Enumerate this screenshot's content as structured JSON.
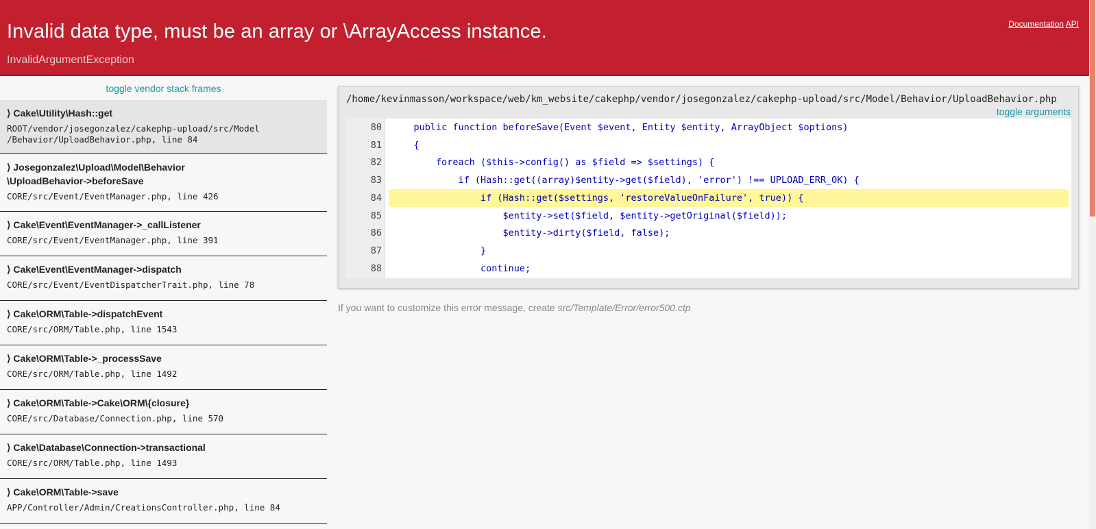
{
  "header": {
    "title": "Invalid data type, must be an array or \\ArrayAccess instance.",
    "exception": "InvalidArgumentException",
    "links": [
      "Documentation",
      "API"
    ]
  },
  "colors": {
    "header_bg": "#c3202f",
    "accent": "#1798a5",
    "highlight": "#fff799"
  },
  "stack": {
    "toggle_label": "toggle vendor stack frames",
    "frames": [
      {
        "fn": "⟩ Cake\\Utility\\Hash::get",
        "loc": "ROOT/vendor/josegonzalez/cakephp-upload/src/Model\n/Behavior/UploadBehavior.php, line 84",
        "active": true
      },
      {
        "fn": "⟩ Josegonzalez\\Upload\\Model\\Behavior\n\\UploadBehavior->beforeSave",
        "loc": "CORE/src/Event/EventManager.php, line 426",
        "active": false
      },
      {
        "fn": "⟩ Cake\\Event\\EventManager->_callListener",
        "loc": "CORE/src/Event/EventManager.php, line 391",
        "active": false
      },
      {
        "fn": "⟩ Cake\\Event\\EventManager->dispatch",
        "loc": "CORE/src/Event/EventDispatcherTrait.php, line 78",
        "active": false
      },
      {
        "fn": "⟩ Cake\\ORM\\Table->dispatchEvent",
        "loc": "CORE/src/ORM/Table.php, line 1543",
        "active": false
      },
      {
        "fn": "⟩ Cake\\ORM\\Table->_processSave",
        "loc": "CORE/src/ORM/Table.php, line 1492",
        "active": false
      },
      {
        "fn": "⟩ Cake\\ORM\\Table->Cake\\ORM\\{closure}",
        "loc": "CORE/src/Database/Connection.php, line 570",
        "active": false
      },
      {
        "fn": "⟩ Cake\\Database\\Connection->transactional",
        "loc": "CORE/src/ORM/Table.php, line 1493",
        "active": false
      },
      {
        "fn": "⟩ Cake\\ORM\\Table->save",
        "loc": "APP/Controller/Admin/CreationsController.php, line 84",
        "active": false
      }
    ]
  },
  "source": {
    "path": "/home/kevinmasson/workspace/web/km_website/cakephp/vendor/josegonzalez/cakephp-upload/src/Model/Behavior/UploadBehavior.php",
    "toggle_args_label": "toggle arguments",
    "highlight_line": 84,
    "lines": [
      {
        "num": "80",
        "code": "    public function beforeSave(Event $event, Entity $entity, ArrayObject $options)"
      },
      {
        "num": "81",
        "code": "    {"
      },
      {
        "num": "82",
        "code": "        foreach ($this->config() as $field => $settings) {"
      },
      {
        "num": "83",
        "code": "            if (Hash::get((array)$entity->get($field), 'error') !== UPLOAD_ERR_OK) {"
      },
      {
        "num": "84",
        "code": "                if (Hash::get($settings, 'restoreValueOnFailure', true)) {"
      },
      {
        "num": "85",
        "code": "                    $entity->set($field, $entity->getOriginal($field));"
      },
      {
        "num": "86",
        "code": "                    $entity->dirty($field, false);"
      },
      {
        "num": "87",
        "code": "                }"
      },
      {
        "num": "88",
        "code": "                continue;"
      }
    ]
  },
  "footer": {
    "message": "If you want to customize this error message, create ",
    "file": "src/Template/Error/error500.ctp"
  }
}
